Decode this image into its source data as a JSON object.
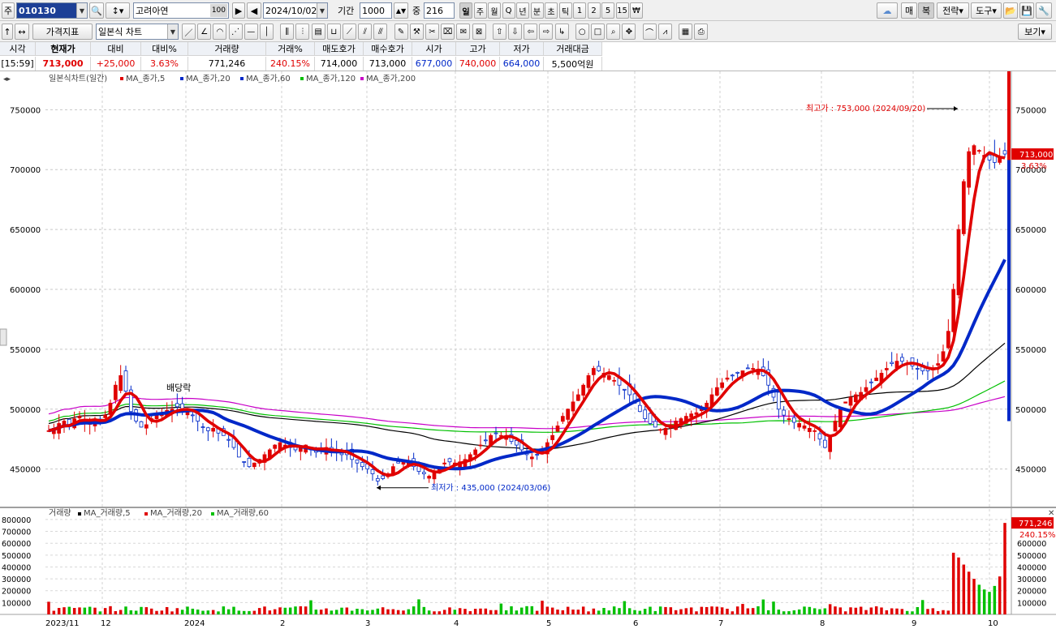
{
  "toolbar": {
    "market_label": "주",
    "stock_code": "010130",
    "stock_name": "고려아연",
    "name_badge": "100",
    "date": "2024/10/02",
    "period_label": "기간",
    "period_value": "1000",
    "count_label": "중",
    "count_value": "216",
    "timeframes": [
      "일",
      "주",
      "월",
      "Q",
      "년",
      "분",
      "초",
      "틱",
      "1",
      "2",
      "5",
      "15",
      "₩"
    ],
    "active_timeframe": "일",
    "right_buttons": [
      "매",
      "복",
      "전략",
      "도구"
    ],
    "price_indicator": "가격지표",
    "chart_type": "일본식 차트",
    "view_button": "보기"
  },
  "quote": {
    "headers": [
      "시각",
      "현재가",
      "대비",
      "대비%",
      "거래량",
      "거래%",
      "매도호가",
      "매수호가",
      "시가",
      "고가",
      "저가",
      "거래대금"
    ],
    "values": [
      "[15:59]",
      "713,000",
      "+25,000",
      "3.63%",
      "771,246",
      "240.15%",
      "714,000",
      "713,000",
      "677,000",
      "740,000",
      "664,000",
      "5,500억원"
    ],
    "value_colors": [
      "#000000",
      "#e00000",
      "#e00000",
      "#e00000",
      "#000000",
      "#e00000",
      "#000000",
      "#000000",
      "#0028c8",
      "#e00000",
      "#0028c8",
      "#000000"
    ]
  },
  "price_legend": {
    "title": "일본식차트(일간)",
    "items": [
      {
        "label": "MA_종가,5",
        "color": "#e00000"
      },
      {
        "label": "MA_종가,20",
        "color": "#0028c8"
      },
      {
        "label": "MA_종가,60",
        "color": "#0028c8"
      },
      {
        "label": "MA_종가,120",
        "color": "#00c000"
      },
      {
        "label": "MA_종가,200",
        "color": "#c800c8"
      }
    ]
  },
  "volume_legend": {
    "title": "거래량",
    "items": [
      {
        "label": "MA_거래량,5",
        "color": "#000000"
      },
      {
        "label": "MA_거래량,20",
        "color": "#e00000"
      },
      {
        "label": "MA_거래량,60",
        "color": "#00c000"
      }
    ]
  },
  "annotations": {
    "high": "최고가 : 753,000 (2024/09/20)",
    "low": "최저가 : 435,000 (2024/03/06)",
    "dividend": "배당락"
  },
  "current_price_tag": "713,000",
  "current_pct_tag": "3.63%",
  "volume_tag": "771,246",
  "volume_pct_tag": "240.15%",
  "colors": {
    "up": "#e00000",
    "down": "#0028c8",
    "ma5": "#e00000",
    "ma20": "#0028c8",
    "ma120": "#00c000",
    "ma200": "#c800c8",
    "ma_other": "#000000",
    "volume_up": "#e00000",
    "volume_down": "#00c000"
  },
  "chart_data": [
    {
      "type": "candlestick",
      "title": "일본식차트(일간)",
      "x_tick_labels": [
        "2023/11",
        "12",
        "2024",
        "2",
        "3",
        "4",
        "5",
        "6",
        "7",
        "8",
        "9",
        "10"
      ],
      "y_ticks": [
        450000,
        500000,
        550000,
        600000,
        650000,
        700000,
        750000
      ],
      "ylim": [
        422000,
        778000
      ],
      "series_daily_close": [
        482000,
        484000,
        488000,
        490000,
        487000,
        492000,
        494000,
        491000,
        489000,
        490000,
        488000,
        495000,
        505000,
        520000,
        528000,
        515000,
        498000,
        490000,
        485000,
        487000,
        492000,
        495000,
        497000,
        499000,
        500000,
        502000,
        500000,
        498000,
        495000,
        490000,
        485000,
        482000,
        484000,
        480000,
        478000,
        474000,
        468000,
        460000,
        456000,
        452000,
        455000,
        458000,
        462000,
        466000,
        470000,
        472000,
        470000,
        468000,
        466000,
        468000,
        470000,
        466000,
        464000,
        466000,
        468000,
        466000,
        464000,
        462000,
        462000,
        458000,
        455000,
        452000,
        450000,
        446000,
        440000,
        442000,
        446000,
        452000,
        455000,
        456000,
        455000,
        452000,
        448000,
        446000,
        444000,
        448000,
        452000,
        455000,
        456000,
        455000,
        456000,
        458000,
        462000,
        466000,
        470000,
        474000,
        478000,
        480000,
        478000,
        476000,
        473000,
        470000,
        466000,
        462000,
        460000,
        462000,
        466000,
        472000,
        478000,
        486000,
        494000,
        500000,
        506000,
        512000,
        520000,
        528000,
        534000,
        532000,
        530000,
        528000,
        524000,
        520000,
        516000,
        512000,
        505000,
        498000,
        492000,
        488000,
        485000,
        483000,
        484000,
        487000,
        490000,
        492000,
        494000,
        496000,
        497000,
        500000,
        505000,
        512000,
        518000,
        522000,
        526000,
        528000,
        530000,
        532000,
        534000,
        534000,
        533000,
        528000,
        520000,
        510000,
        500000,
        495000,
        492000,
        489000,
        488000,
        486000,
        484000,
        482000,
        475000,
        468000,
        478000,
        490000,
        500000,
        506000,
        510000,
        512000,
        514000,
        518000,
        522000,
        526000,
        530000,
        534000,
        538000,
        540000,
        540000,
        538000,
        536000,
        534000,
        532000,
        532000,
        534000,
        538000,
        548000,
        565000,
        600000,
        650000,
        690000,
        715000,
        720000,
        716000,
        712000,
        708000,
        706000,
        710000,
        713000
      ],
      "moving_averages": [
        {
          "name": "MA_종가,5",
          "period": 5
        },
        {
          "name": "MA_종가,20",
          "period": 20
        },
        {
          "name": "MA_종가,60",
          "period": 60
        },
        {
          "name": "MA_종가,120",
          "period": 120
        },
        {
          "name": "MA_종가,200",
          "period": 200
        }
      ],
      "high_point": {
        "value": 753000,
        "date": "2024/09/20"
      },
      "low_point": {
        "value": 435000,
        "date": "2024/03/06"
      },
      "last_close": 713000
    },
    {
      "type": "bar",
      "title": "거래량",
      "y_ticks": [
        100000,
        200000,
        300000,
        400000,
        500000,
        600000,
        700000,
        800000
      ],
      "ylim": [
        0,
        820000
      ],
      "last_volume": 771246,
      "spike_volumes": [
        520000,
        480000,
        420000,
        360000,
        300000,
        250000,
        210000,
        190000,
        240000,
        320000,
        771246
      ]
    }
  ]
}
